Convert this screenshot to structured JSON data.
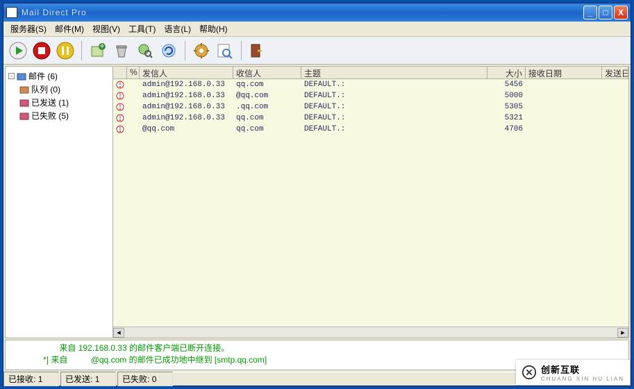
{
  "window": {
    "title": "Mail Direct Pro"
  },
  "menu": {
    "server": "服务器(S)",
    "mail": "邮件(M)",
    "view": "视图(V)",
    "tools": "工具(T)",
    "lang": "语言(L)",
    "help": "帮助(H)"
  },
  "tree": {
    "root": "邮件 (6)",
    "queue": "队列 (0)",
    "sent": "已发送 (1)",
    "failed": "已失败 (5)"
  },
  "columns": {
    "icon": "",
    "pct": "%",
    "from": "发信人",
    "to": "收信人",
    "subject": "主题",
    "size": "大小",
    "recv": "接收日期",
    "send": "发送日期"
  },
  "rows": [
    {
      "from": "admin@192.168.0.33",
      "to": "qq.com",
      "subject": "DEFAULT.:",
      "size": "5456",
      "recv": ""
    },
    {
      "from": "admin@192.168.0.33",
      "to": "@qq.com",
      "subject": "DEFAULT.:",
      "size": "5000",
      "recv": ""
    },
    {
      "from": "admin@192.168.0.33",
      "to": ".qq.com",
      "subject": "DEFAULT.:",
      "size": "5305",
      "recv": ""
    },
    {
      "from": "admin@192.168.0.33",
      "to": "qq.com",
      "subject": "DEFAULT.:",
      "size": "5321",
      "recv": ""
    },
    {
      "from": "@qq.com",
      "to": "qq.com",
      "subject": "DEFAULT.:",
      "size": "4706",
      "recv": ""
    }
  ],
  "log": {
    "line1": "来自 192.168.0.33 的邮件客户端已断开连接。",
    "line2_prefix": "*] 来自",
    "line2_body": "@qq.com 的邮件已成功地中继到 [smtp.qq.com]"
  },
  "status": {
    "received_label": "已接收:",
    "received_val": "1",
    "sent_label": "已发送:",
    "sent_val": "1",
    "failed_label": "已失败:",
    "failed_val": "0"
  },
  "watermark": {
    "brand": "创新互联",
    "sub": "CHUANG XIN HU LIAN"
  }
}
